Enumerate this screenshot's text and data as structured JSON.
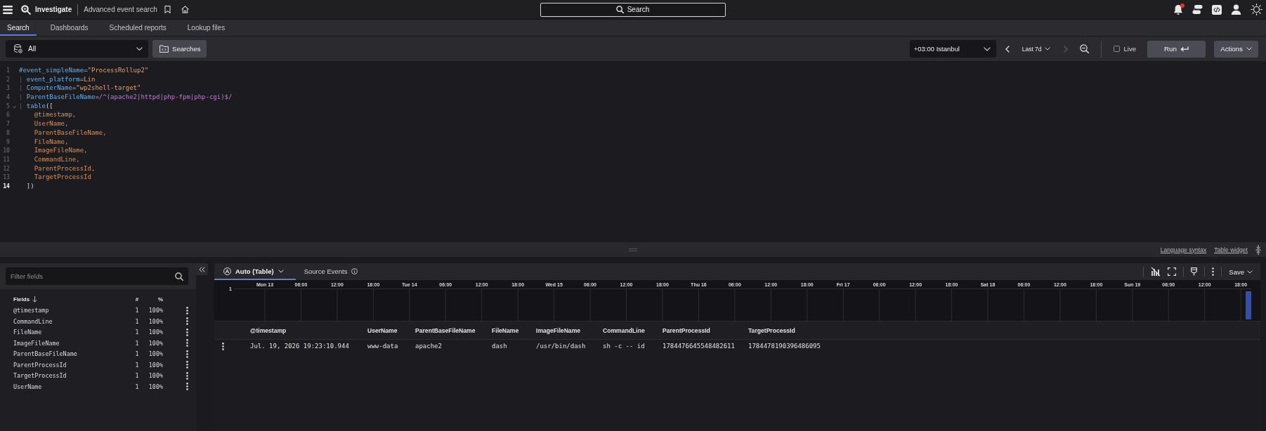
{
  "top_bar": {
    "app_name": "Investigate",
    "page_title": "Advanced event search",
    "search_label": "Search",
    "notifications_unread": true
  },
  "tabs": [
    {
      "label": "Search",
      "selected": true
    },
    {
      "label": "Dashboards",
      "selected": false
    },
    {
      "label": "Scheduled reports",
      "selected": false
    },
    {
      "label": "Lookup files",
      "selected": false
    }
  ],
  "toolbar": {
    "repository": "All",
    "searches_button": "Searches",
    "timezone": "+03:00 Istanbul",
    "time_range": "Last 7d",
    "previous_disabled": false,
    "next_disabled": true,
    "live": {
      "label": "Live",
      "checked": false
    },
    "run_button": "Run",
    "actions_button": "Actions"
  },
  "editor": {
    "lines": [
      {
        "number": "1",
        "current": false,
        "foldable": false,
        "tokens": [
          {
            "kind": "field",
            "text": "#event_simpleName"
          },
          {
            "kind": "op",
            "text": "="
          },
          {
            "kind": "string",
            "text": "\"ProcessRollup2\""
          }
        ]
      },
      {
        "number": "2",
        "current": false,
        "foldable": false,
        "tokens": [
          {
            "kind": "pipe",
            "text": "| "
          },
          {
            "kind": "field",
            "text": "event_platform"
          },
          {
            "kind": "op",
            "text": "="
          },
          {
            "kind": "value",
            "text": "Lin"
          }
        ]
      },
      {
        "number": "3",
        "current": false,
        "foldable": false,
        "tokens": [
          {
            "kind": "pipe",
            "text": "| "
          },
          {
            "kind": "field",
            "text": "ComputerName"
          },
          {
            "kind": "op",
            "text": "="
          },
          {
            "kind": "string",
            "text": "\"wp2shell-target\""
          }
        ]
      },
      {
        "number": "4",
        "current": false,
        "foldable": false,
        "tokens": [
          {
            "kind": "pipe",
            "text": "| "
          },
          {
            "kind": "field",
            "text": "ParentBaseFileName"
          },
          {
            "kind": "op",
            "text": "="
          },
          {
            "kind": "regex",
            "text": "/^(apache2|httpd|php-fpm|php-cgi)$/"
          }
        ]
      },
      {
        "number": "5",
        "current": false,
        "foldable": true,
        "tokens": [
          {
            "kind": "pipe",
            "text": "| "
          },
          {
            "kind": "function",
            "text": "table"
          },
          {
            "kind": "punct",
            "text": "(["
          }
        ]
      },
      {
        "number": "6",
        "current": false,
        "foldable": false,
        "tokens": [
          {
            "kind": "arg",
            "text": "    @timestamp,"
          }
        ]
      },
      {
        "number": "7",
        "current": false,
        "foldable": false,
        "tokens": [
          {
            "kind": "arg",
            "text": "    UserName,"
          }
        ]
      },
      {
        "number": "8",
        "current": false,
        "foldable": false,
        "tokens": [
          {
            "kind": "arg",
            "text": "    ParentBaseFileName,"
          }
        ]
      },
      {
        "number": "9",
        "current": false,
        "foldable": false,
        "tokens": [
          {
            "kind": "arg",
            "text": "    FileName,"
          }
        ]
      },
      {
        "number": "10",
        "current": false,
        "foldable": false,
        "tokens": [
          {
            "kind": "arg",
            "text": "    ImageFileName,"
          }
        ]
      },
      {
        "number": "11",
        "current": false,
        "foldable": false,
        "tokens": [
          {
            "kind": "arg",
            "text": "    CommandLine,"
          }
        ]
      },
      {
        "number": "12",
        "current": false,
        "foldable": false,
        "tokens": [
          {
            "kind": "arg",
            "text": "    ParentProcessId,"
          }
        ]
      },
      {
        "number": "13",
        "current": false,
        "foldable": false,
        "tokens": [
          {
            "kind": "arg",
            "text": "    TargetProcessId"
          }
        ]
      },
      {
        "number": "14",
        "current": true,
        "foldable": false,
        "tokens": [
          {
            "kind": "punct",
            "text": "  ])"
          }
        ]
      }
    ]
  },
  "editor_links": [
    "Language syntax",
    "Table widget"
  ],
  "fields_panel": {
    "filter_placeholder": "Filter fields",
    "columns": [
      {
        "label": "Fields",
        "sorted": true
      },
      {
        "label": "#",
        "sorted": false
      },
      {
        "label": "%",
        "sorted": false
      }
    ],
    "rows": [
      {
        "name": "@timestamp",
        "count": "1",
        "percent": "100%"
      },
      {
        "name": "CommandLine",
        "count": "1",
        "percent": "100%"
      },
      {
        "name": "FileName",
        "count": "1",
        "percent": "100%"
      },
      {
        "name": "ImageFileName",
        "count": "1",
        "percent": "100%"
      },
      {
        "name": "ParentBaseFileName",
        "count": "1",
        "percent": "100%"
      },
      {
        "name": "ParentProcessId",
        "count": "1",
        "percent": "100%"
      },
      {
        "name": "TargetProcessId",
        "count": "1",
        "percent": "100%"
      },
      {
        "name": "UserName",
        "count": "1",
        "percent": "100%"
      }
    ]
  },
  "results": {
    "tabs": [
      {
        "label": "Auto (Table)",
        "kind": "view",
        "selected": true
      },
      {
        "label": "Source Events",
        "kind": "info",
        "selected": false
      }
    ],
    "save_button": "Save",
    "timeline": {
      "y_tick": "1",
      "x_ticks": [
        "Mon 13",
        "06:00",
        "12:00",
        "18:00",
        "Tue 14",
        "06:00",
        "12:00",
        "18:00",
        "Wed 15",
        "06:00",
        "12:00",
        "18:00",
        "Thu 16",
        "06:00",
        "12:00",
        "18:00",
        "Fri 17",
        "06:00",
        "12:00",
        "18:00",
        "Sat 18",
        "06:00",
        "12:00",
        "18:00",
        "Sun 19",
        "06:00",
        "12:00",
        "18:00"
      ]
    },
    "table": {
      "columns": [
        "@timestamp",
        "UserName",
        "ParentBaseFileName",
        "FileName",
        "ImageFileName",
        "CommandLine",
        "ParentProcessId",
        "TargetProcessId"
      ],
      "rows": [
        {
          "cells": [
            "Jul. 19, 2026 19:23:10.944",
            "www-data",
            "apache2",
            "dash",
            "/usr/bin/dash",
            "sh -c -- id",
            "1784476645548482611",
            "1784478190396486095"
          ]
        }
      ]
    }
  }
}
